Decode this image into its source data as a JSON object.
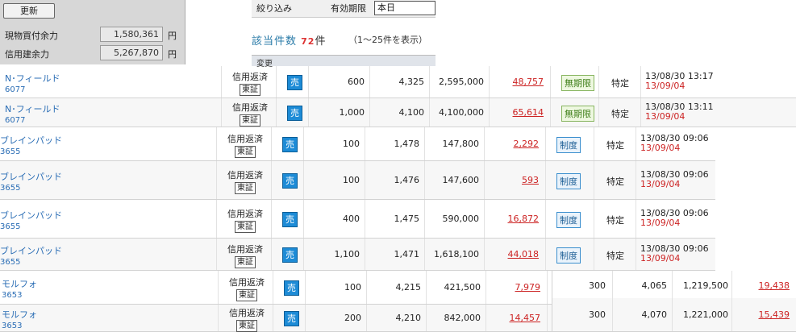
{
  "panel": {
    "refresh": "更新",
    "rows": [
      {
        "label": "現物買付余力",
        "value": "1,580,361",
        "unit": "円"
      },
      {
        "label": "信用建余力",
        "value": "5,267,870",
        "unit": "円"
      }
    ]
  },
  "filter": {
    "label": "絞り込み",
    "expiry_label": "有効期限",
    "expiry_value": "本日"
  },
  "count": {
    "label": "該当件数",
    "num": "72",
    "unit": "件",
    "range": "（1～25件を表示）"
  },
  "header": {
    "col1": "変更"
  },
  "rows": [
    {
      "name": "N･フィールド",
      "code": "6077",
      "type": "信用返済",
      "exchange": "東証",
      "side": "売",
      "qty": "600",
      "price": "4,325",
      "amount": "2,595,000",
      "pl": "48,757",
      "condition": "無期限",
      "account": "特定",
      "date1": "13/08/30 13:17",
      "date2": "13/09/04"
    },
    {
      "name": "N･フィールド",
      "code": "6077",
      "type": "信用返済",
      "exchange": "東証",
      "side": "売",
      "qty": "1,000",
      "price": "4,100",
      "amount": "4,100,000",
      "pl": "65,614",
      "condition": "無期限",
      "account": "特定",
      "date1": "13/08/30 13:11",
      "date2": "13/09/04"
    },
    {
      "name": "ブレインパッド",
      "code": "3655",
      "type": "信用返済",
      "exchange": "東証",
      "side": "売",
      "qty": "100",
      "price": "1,478",
      "amount": "147,800",
      "pl": "2,292",
      "condition": "制度",
      "account": "特定",
      "date1": "13/08/30 09:06",
      "date2": "13/09/04"
    },
    {
      "name": "ブレインパッド",
      "code": "3655",
      "type": "信用返済",
      "exchange": "東証",
      "side": "売",
      "qty": "100",
      "price": "1,476",
      "amount": "147,600",
      "pl": "593",
      "condition": "制度",
      "account": "特定",
      "date1": "13/08/30 09:06",
      "date2": "13/09/04"
    },
    {
      "name": "ブレインパッド",
      "code": "3655",
      "type": "信用返済",
      "exchange": "東証",
      "side": "売",
      "qty": "400",
      "price": "1,475",
      "amount": "590,000",
      "pl": "16,872",
      "condition": "制度",
      "account": "特定",
      "date1": "13/08/30 09:06",
      "date2": "13/09/04"
    },
    {
      "name": "ブレインパッド",
      "code": "3655",
      "type": "信用返済",
      "exchange": "東証",
      "side": "売",
      "qty": "1,100",
      "price": "1,471",
      "amount": "1,618,100",
      "pl": "44,018",
      "condition": "制度",
      "account": "特定",
      "date1": "13/08/30 09:06",
      "date2": "13/09/04"
    },
    {
      "name": "モルフォ",
      "code": "3653",
      "type": "信用返済",
      "exchange": "東証",
      "side": "売",
      "qty": "100",
      "price": "4,215",
      "amount": "421,500",
      "pl": "7,979"
    },
    {
      "name": "モルフォ",
      "code": "3653",
      "type": "信用返済",
      "exchange": "東証",
      "side": "売",
      "qty": "200",
      "price": "4,210",
      "amount": "842,000",
      "pl": "14,457"
    }
  ],
  "overlay": [
    {
      "qty": "300",
      "price": "4,065",
      "amount": "1,219,500",
      "pl": "19,438"
    },
    {
      "qty": "300",
      "price": "4,070",
      "amount": "1,221,000",
      "pl": "15,439"
    }
  ]
}
